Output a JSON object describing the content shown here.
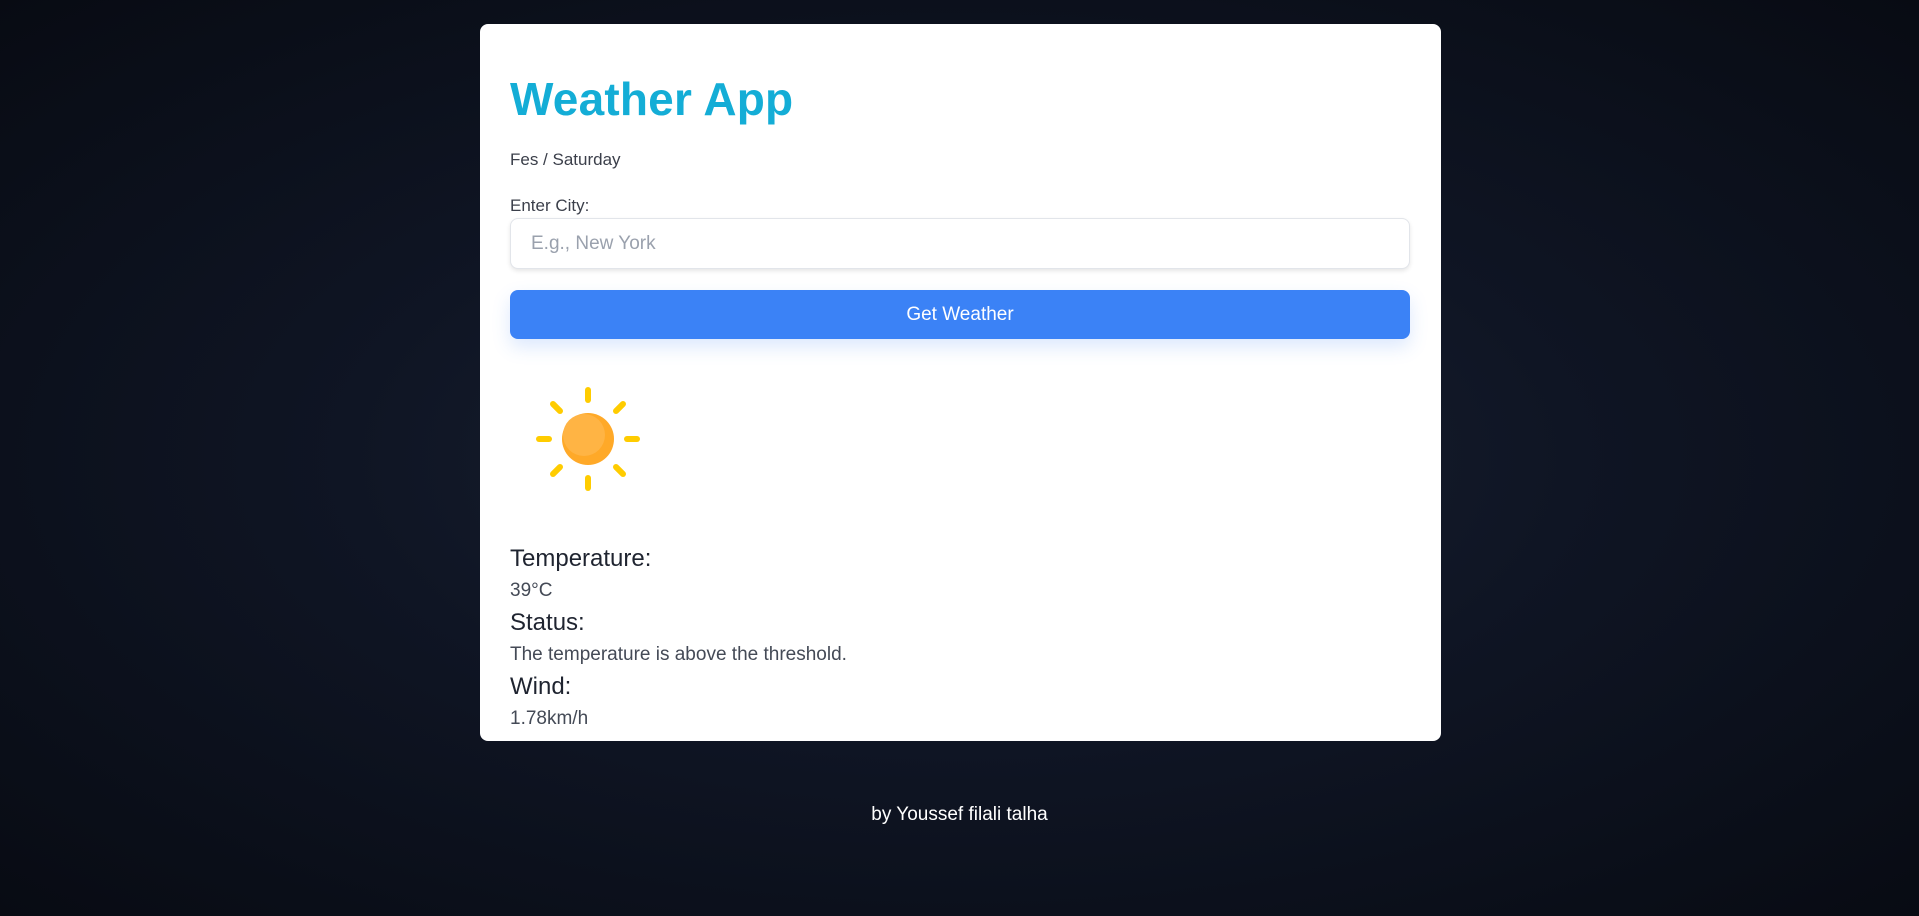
{
  "app": {
    "title": "Weather App",
    "location_day": "Fes / Saturday"
  },
  "form": {
    "city_label": "Enter City:",
    "city_placeholder": "E.g., New York",
    "city_value": "",
    "submit_label": "Get Weather"
  },
  "weather": {
    "icon": "sun-icon",
    "temperature_label": "Temperature:",
    "temperature_value": "39°C",
    "status_label": "Status:",
    "status_value": "The temperature is above the threshold.",
    "wind_label": "Wind:",
    "wind_value": "1.78km/h"
  },
  "footer": {
    "credit": "by Youssef filali talha"
  },
  "colors": {
    "title": "#14add6",
    "button": "#3b82f6",
    "sun_core": "#ffa928",
    "sun_rays": "#ffcc00",
    "background": "#0f1524"
  }
}
